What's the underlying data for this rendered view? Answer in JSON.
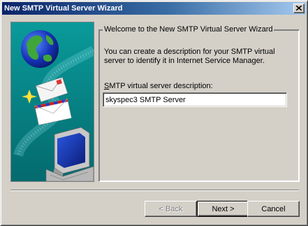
{
  "window": {
    "title": "New SMTP Virtual Server Wizard",
    "close_icon": "close-icon"
  },
  "illustration": {
    "icons": [
      "globe-icon",
      "envelope-icon",
      "computer-icon",
      "sparkle-icon"
    ]
  },
  "group": {
    "title": "Welcome to the New SMTP Virtual Server Wizard",
    "intro_line1": "You can create a description for your SMTP virtual",
    "intro_line2": "server to identify it in Internet Service Manager."
  },
  "description": {
    "label_accel": "S",
    "label_rest": "MTP virtual server description:",
    "value": "skyspec3 SMTP Server"
  },
  "buttons": {
    "back": "< Back",
    "next": "Next >",
    "cancel": "Cancel"
  },
  "colors": {
    "title_start": "#0a246a",
    "title_end": "#a6caf0",
    "face": "#d4d0c8"
  }
}
